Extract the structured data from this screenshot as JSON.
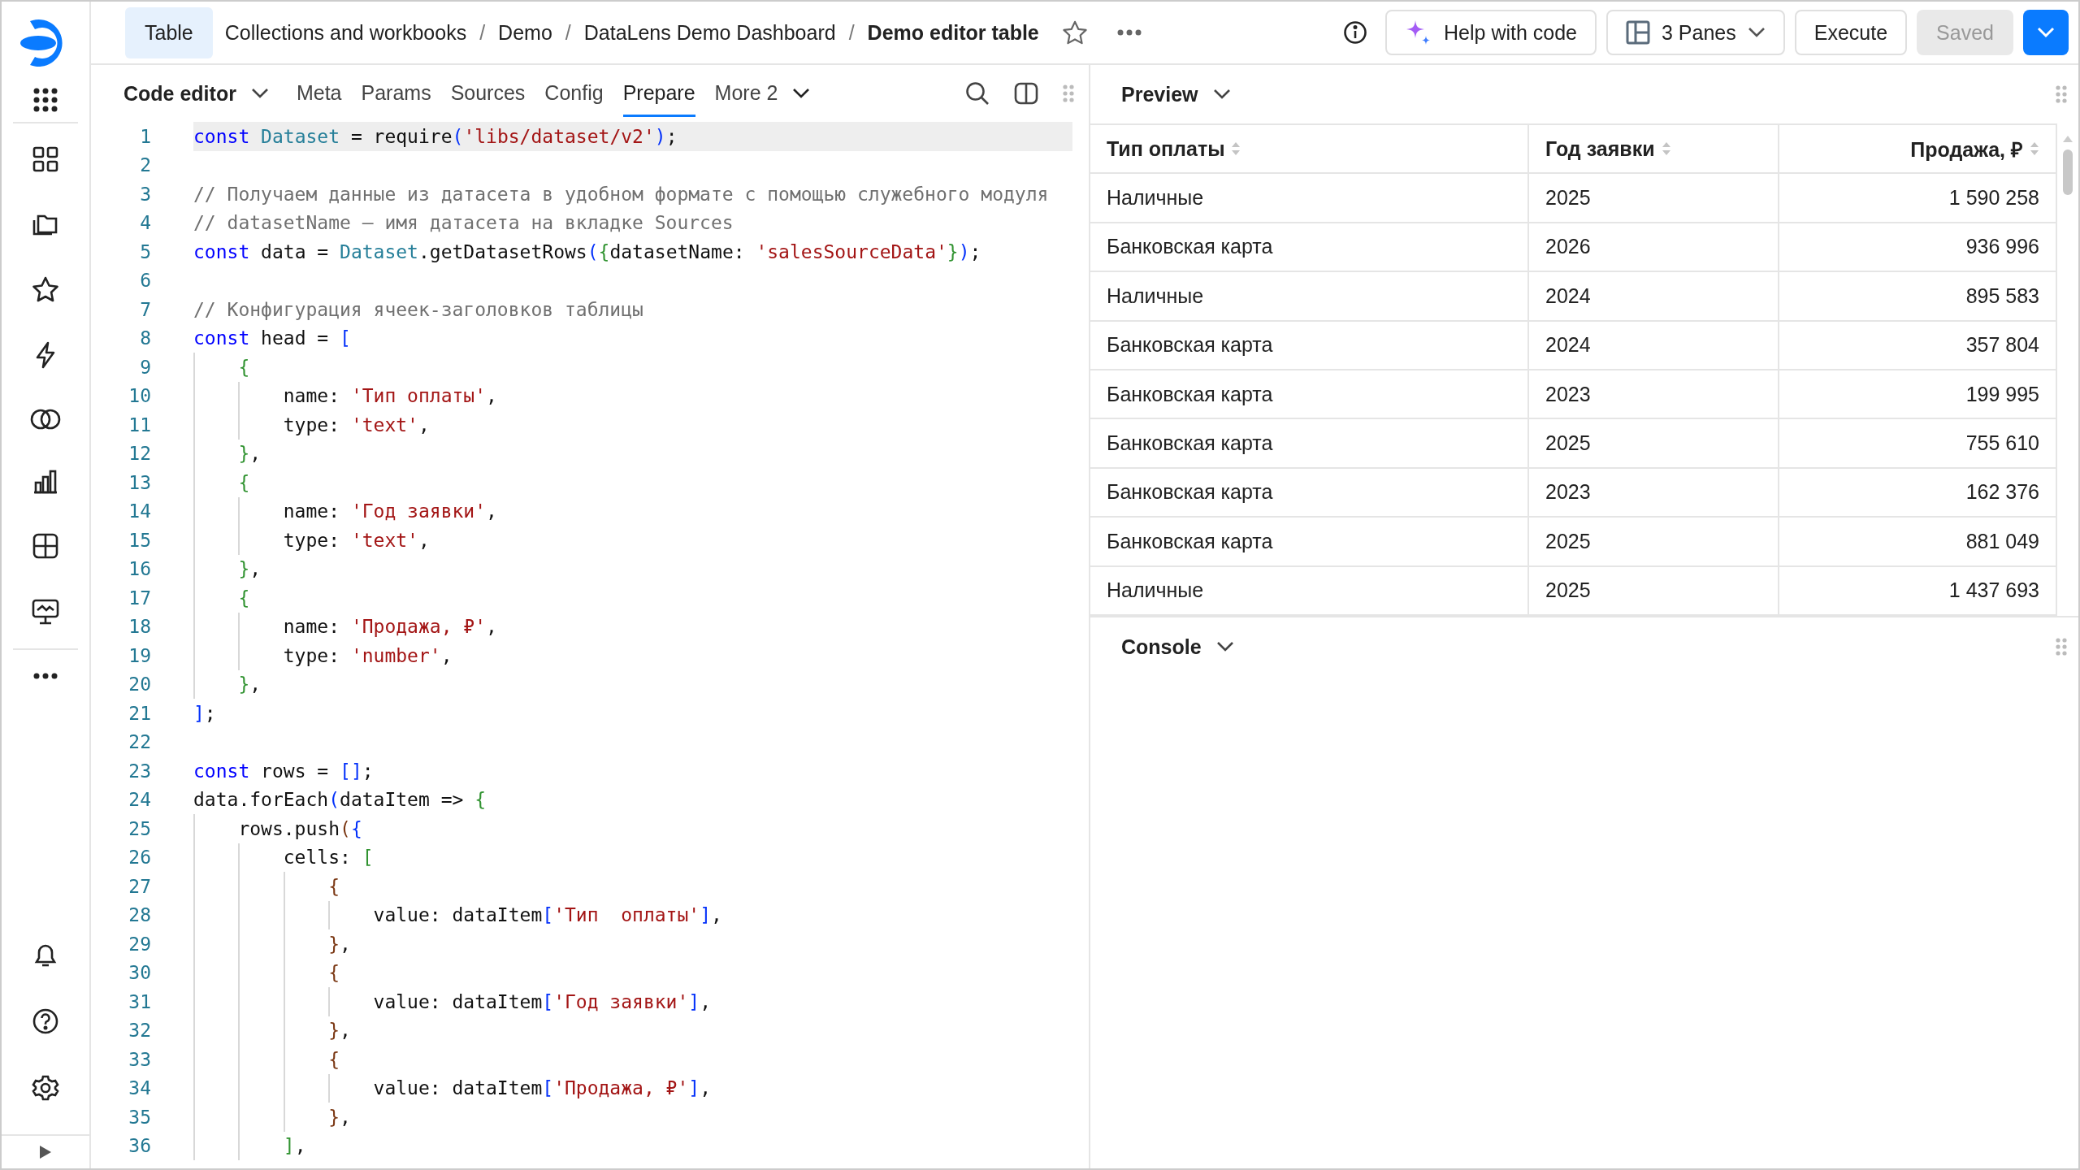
{
  "topbar": {
    "entry_type": "Table",
    "breadcrumbs": [
      {
        "label": "Collections and workbooks",
        "current": false
      },
      {
        "label": "Demo",
        "current": false
      },
      {
        "label": "DataLens Demo Dashboard",
        "current": false
      },
      {
        "label": "Demo editor table",
        "current": true
      }
    ],
    "separators": [
      "/",
      "/",
      "/"
    ],
    "favorite": false,
    "buttons": [
      {
        "kind": "ai",
        "label": "Help with code",
        "disabled": false
      },
      {
        "kind": "panes",
        "label": "3 Panes",
        "disabled": false
      },
      {
        "kind": "plain",
        "label": "Execute",
        "disabled": false
      },
      {
        "kind": "plain",
        "label": "Saved",
        "disabled": true
      }
    ]
  },
  "editor": {
    "mode": "Code editor",
    "tabs": [
      {
        "label": "Meta",
        "selected": false
      },
      {
        "label": "Params",
        "selected": false
      },
      {
        "label": "Sources",
        "selected": false
      },
      {
        "label": "Config",
        "selected": false
      },
      {
        "label": "Prepare",
        "selected": true
      },
      {
        "label": "More 2",
        "selected": false
      }
    ],
    "lines": [
      {
        "number": "1",
        "current": true,
        "tokens": [
          {
            "kind": "kw",
            "text": "const "
          },
          {
            "kind": "cls",
            "text": "Dataset"
          },
          {
            "kind": "plain",
            "text": " = require"
          },
          {
            "kind": "b1",
            "text": "("
          },
          {
            "kind": "str",
            "text": "'libs/dataset/v2'"
          },
          {
            "kind": "b1",
            "text": ")"
          },
          {
            "kind": "plain",
            "text": ";"
          }
        ]
      },
      {
        "number": "2",
        "current": false
      },
      {
        "number": "3",
        "current": false,
        "tokens": [
          {
            "kind": "cmt",
            "text": "// Получаем данные из датасета в удобном формате с помощью служебного модуля"
          }
        ]
      },
      {
        "number": "4",
        "current": false,
        "tokens": [
          {
            "kind": "cmt",
            "text": "// datasetName — имя датасета на вкладке Sources"
          }
        ]
      },
      {
        "number": "5",
        "current": false,
        "tokens": [
          {
            "kind": "kw",
            "text": "const"
          },
          {
            "kind": "plain",
            "text": " data = "
          },
          {
            "kind": "cls",
            "text": "Dataset"
          },
          {
            "kind": "plain",
            "text": ".getDatasetRows"
          },
          {
            "kind": "b1",
            "text": "("
          },
          {
            "kind": "b2",
            "text": "{"
          },
          {
            "kind": "plain",
            "text": "datasetName: "
          },
          {
            "kind": "str",
            "text": "'salesSourceData'"
          },
          {
            "kind": "b2",
            "text": "}"
          },
          {
            "kind": "b1",
            "text": ")"
          },
          {
            "kind": "plain",
            "text": ";"
          }
        ]
      },
      {
        "number": "6",
        "current": false
      },
      {
        "number": "7",
        "current": false,
        "tokens": [
          {
            "kind": "cmt",
            "text": "// Конфигурация ячеек-заголовков таблицы"
          }
        ]
      },
      {
        "number": "8",
        "current": false,
        "tokens": [
          {
            "kind": "kw",
            "text": "const"
          },
          {
            "kind": "plain",
            "text": " head = "
          },
          {
            "kind": "b1",
            "text": "["
          }
        ]
      },
      {
        "number": "9",
        "current": false,
        "tokens": [
          {
            "kind": "b2",
            "text": "    {"
          }
        ]
      },
      {
        "number": "10",
        "current": false,
        "tokens": [
          {
            "kind": "plain",
            "text": "        name: "
          },
          {
            "kind": "str",
            "text": "'Тип оплаты'"
          },
          {
            "kind": "plain",
            "text": ","
          }
        ]
      },
      {
        "number": "11",
        "current": false,
        "tokens": [
          {
            "kind": "plain",
            "text": "        type: "
          },
          {
            "kind": "str",
            "text": "'text'"
          },
          {
            "kind": "plain",
            "text": ","
          }
        ]
      },
      {
        "number": "12",
        "current": false,
        "tokens": [
          {
            "kind": "b2",
            "text": "    }"
          },
          {
            "kind": "plain",
            "text": ","
          }
        ]
      },
      {
        "number": "13",
        "current": false,
        "tokens": [
          {
            "kind": "b2",
            "text": "    {"
          }
        ]
      },
      {
        "number": "14",
        "current": false,
        "tokens": [
          {
            "kind": "plain",
            "text": "        name: "
          },
          {
            "kind": "str",
            "text": "'Год заявки'"
          },
          {
            "kind": "plain",
            "text": ","
          }
        ]
      },
      {
        "number": "15",
        "current": false,
        "tokens": [
          {
            "kind": "plain",
            "text": "        type: "
          },
          {
            "kind": "str",
            "text": "'text'"
          },
          {
            "kind": "plain",
            "text": ","
          }
        ]
      },
      {
        "number": "16",
        "current": false,
        "tokens": [
          {
            "kind": "b2",
            "text": "    }"
          },
          {
            "kind": "plain",
            "text": ","
          }
        ]
      },
      {
        "number": "17",
        "current": false,
        "tokens": [
          {
            "kind": "b2",
            "text": "    {"
          }
        ]
      },
      {
        "number": "18",
        "current": false,
        "tokens": [
          {
            "kind": "plain",
            "text": "        name: "
          },
          {
            "kind": "str",
            "text": "'Продажа, ₽'"
          },
          {
            "kind": "plain",
            "text": ","
          }
        ]
      },
      {
        "number": "19",
        "current": false,
        "tokens": [
          {
            "kind": "plain",
            "text": "        type: "
          },
          {
            "kind": "str",
            "text": "'number'"
          },
          {
            "kind": "plain",
            "text": ","
          }
        ]
      },
      {
        "number": "20",
        "current": false,
        "tokens": [
          {
            "kind": "b2",
            "text": "    }"
          },
          {
            "kind": "plain",
            "text": ","
          }
        ]
      },
      {
        "number": "21",
        "current": false,
        "tokens": [
          {
            "kind": "b1",
            "text": "]"
          },
          {
            "kind": "plain",
            "text": ";"
          }
        ]
      },
      {
        "number": "22",
        "current": false
      },
      {
        "number": "23",
        "current": false,
        "tokens": [
          {
            "kind": "kw",
            "text": "const"
          },
          {
            "kind": "plain",
            "text": " rows = "
          },
          {
            "kind": "b1",
            "text": "[]"
          },
          {
            "kind": "plain",
            "text": ";"
          }
        ]
      },
      {
        "number": "24",
        "current": false,
        "tokens": [
          {
            "kind": "plain",
            "text": "data.forEach"
          },
          {
            "kind": "b1",
            "text": "("
          },
          {
            "kind": "plain",
            "text": "dataItem => "
          },
          {
            "kind": "b2",
            "text": "{"
          }
        ]
      },
      {
        "number": "25",
        "current": false,
        "tokens": [
          {
            "kind": "plain",
            "text": "    rows.push"
          },
          {
            "kind": "b3",
            "text": "("
          },
          {
            "kind": "b1",
            "text": "{"
          }
        ]
      },
      {
        "number": "26",
        "current": false,
        "tokens": [
          {
            "kind": "plain",
            "text": "        cells: "
          },
          {
            "kind": "b2",
            "text": "["
          }
        ]
      },
      {
        "number": "27",
        "current": false,
        "tokens": [
          {
            "kind": "b3",
            "text": "            {"
          }
        ]
      },
      {
        "number": "28",
        "current": false,
        "tokens": [
          {
            "kind": "plain",
            "text": "                value: dataItem"
          },
          {
            "kind": "b1",
            "text": "["
          },
          {
            "kind": "str",
            "text": "'Тип  оплаты'"
          },
          {
            "kind": "b1",
            "text": "]"
          },
          {
            "kind": "plain",
            "text": ","
          }
        ]
      },
      {
        "number": "29",
        "current": false,
        "tokens": [
          {
            "kind": "b3",
            "text": "            }"
          },
          {
            "kind": "plain",
            "text": ","
          }
        ]
      },
      {
        "number": "30",
        "current": false,
        "tokens": [
          {
            "kind": "b3",
            "text": "            {"
          }
        ]
      },
      {
        "number": "31",
        "current": false,
        "tokens": [
          {
            "kind": "plain",
            "text": "                value: dataItem"
          },
          {
            "kind": "b1",
            "text": "["
          },
          {
            "kind": "str",
            "text": "'Год заявки'"
          },
          {
            "kind": "b1",
            "text": "]"
          },
          {
            "kind": "plain",
            "text": ","
          }
        ]
      },
      {
        "number": "32",
        "current": false,
        "tokens": [
          {
            "kind": "b3",
            "text": "            }"
          },
          {
            "kind": "plain",
            "text": ","
          }
        ]
      },
      {
        "number": "33",
        "current": false,
        "tokens": [
          {
            "kind": "b3",
            "text": "            {"
          }
        ]
      },
      {
        "number": "34",
        "current": false,
        "tokens": [
          {
            "kind": "plain",
            "text": "                value: dataItem"
          },
          {
            "kind": "b1",
            "text": "["
          },
          {
            "kind": "str",
            "text": "'Продажа, ₽'"
          },
          {
            "kind": "b1",
            "text": "]"
          },
          {
            "kind": "plain",
            "text": ","
          }
        ]
      },
      {
        "number": "35",
        "current": false,
        "tokens": [
          {
            "kind": "b3",
            "text": "            }"
          },
          {
            "kind": "plain",
            "text": ","
          }
        ]
      },
      {
        "number": "36",
        "current": false,
        "tokens": [
          {
            "kind": "b2",
            "text": "        ]"
          },
          {
            "kind": "plain",
            "text": ","
          }
        ]
      }
    ]
  },
  "preview": {
    "title": "Preview",
    "table": {
      "columns": [
        {
          "label": "Тип оплаты",
          "kind": "text"
        },
        {
          "label": "Год заявки",
          "kind": "text"
        },
        {
          "label": "Продажа, ₽",
          "kind": "number"
        }
      ],
      "rows": [
        [
          "Наличные",
          "2025",
          "1 590 258"
        ],
        [
          "Банковская карта",
          "2026",
          "936 996"
        ],
        [
          "Наличные",
          "2024",
          "895 583"
        ],
        [
          "Банковская карта",
          "2024",
          "357 804"
        ],
        [
          "Банковская карта",
          "2023",
          "199 995"
        ],
        [
          "Банковская карта",
          "2025",
          "755 610"
        ],
        [
          "Банковская карта",
          "2023",
          "162 376"
        ],
        [
          "Банковская карта",
          "2025",
          "881 049"
        ],
        [
          "Наличные",
          "2025",
          "1 437 693"
        ]
      ]
    }
  },
  "console": {
    "title": "Console"
  }
}
